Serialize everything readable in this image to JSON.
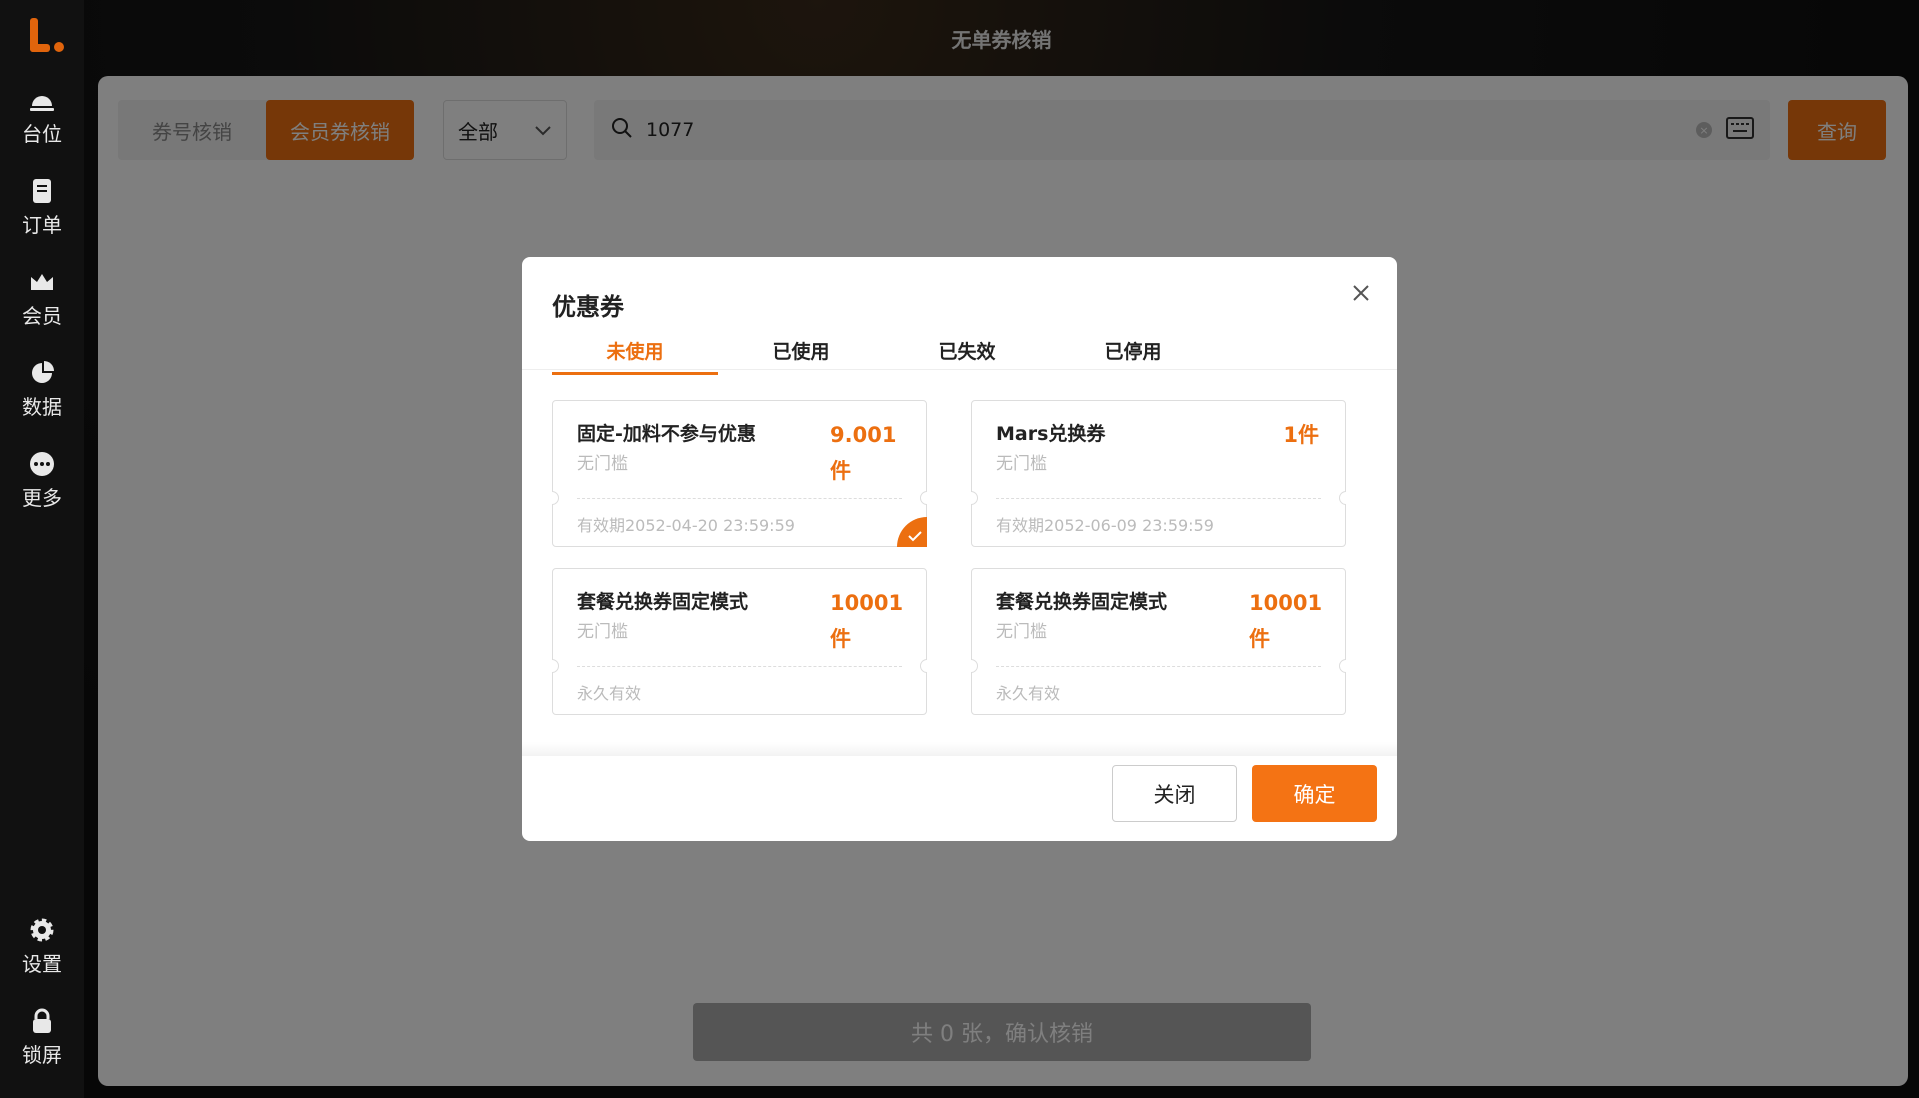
{
  "app": {
    "title": "无单券核销"
  },
  "sidebar": {
    "top_items": [
      {
        "label": "台位",
        "icon": "table-bell-icon"
      },
      {
        "label": "订单",
        "icon": "order-doc-icon"
      },
      {
        "label": "会员",
        "icon": "member-crown-icon"
      },
      {
        "label": "数据",
        "icon": "pie-chart-icon"
      },
      {
        "label": "更多",
        "icon": "more-dots-icon"
      }
    ],
    "bottom_items": [
      {
        "label": "设置",
        "icon": "gear-icon"
      },
      {
        "label": "锁屏",
        "icon": "lock-icon"
      }
    ]
  },
  "toolbar": {
    "seg_coupon_no": "券号核销",
    "seg_member": "会员券核销",
    "select_value": "全部",
    "search_value": "1077",
    "query_label": "查询"
  },
  "footer": {
    "confirm_label": "共 0 张，确认核销"
  },
  "modal": {
    "title": "优惠券",
    "tabs": [
      "未使用",
      "已使用",
      "已失效",
      "已停用"
    ],
    "coupons": [
      {
        "name": "固定-加料不参与优惠",
        "threshold": "无门槛",
        "qty": "9.001件",
        "valid": "有效期2052-04-20 23:59:59",
        "selected": true
      },
      {
        "name": "Mars兑换券",
        "threshold": "无门槛",
        "qty": "1件",
        "valid": "有效期2052-06-09 23:59:59",
        "selected": false
      },
      {
        "name": "套餐兑换券固定模式",
        "threshold": "无门槛",
        "qty": "10001件",
        "valid": "永久有效",
        "selected": false
      },
      {
        "name": "套餐兑换券固定模式",
        "threshold": "无门槛",
        "qty": "10001件",
        "valid": "永久有效",
        "selected": false
      }
    ],
    "cancel_label": "关闭",
    "ok_label": "确定"
  },
  "colors": {
    "accent": "#ec6f10",
    "sidebar_bg": "#111111"
  }
}
